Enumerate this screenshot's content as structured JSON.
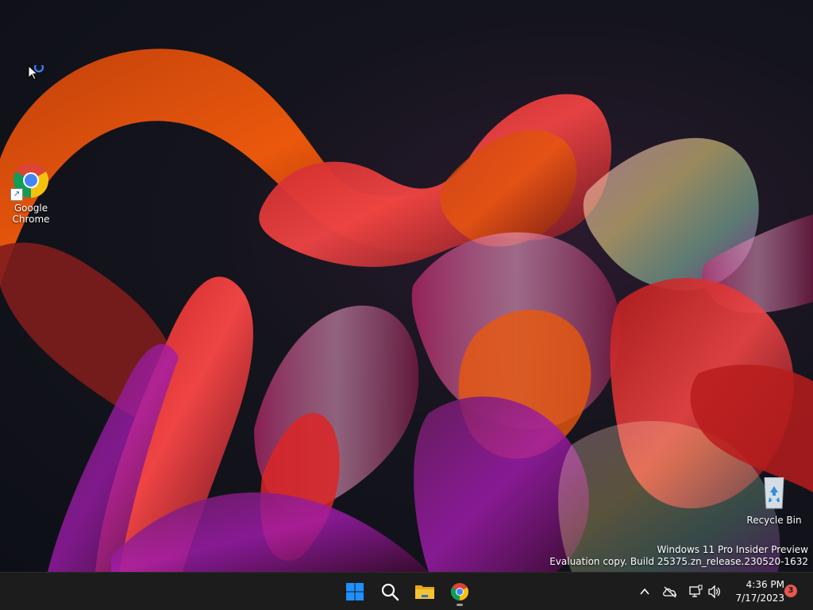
{
  "desktop": {
    "icons": [
      {
        "label": "Google Chrome"
      },
      {
        "label": "Recycle Bin"
      }
    ],
    "watermark": {
      "line1": "Windows 11 Pro Insider Preview",
      "line2": "Evaluation copy. Build 25375.zn_release.230520-1632"
    }
  },
  "taskbar": {
    "clock": {
      "time": "4:36 PM",
      "date": "7/17/2023"
    },
    "notification_count": "3"
  },
  "colors": {
    "taskbar_bg": "#1c1c1c",
    "start_blue": "#1e90ff",
    "folder_yellow": "#f4c430",
    "badge_red": "#e8574f"
  }
}
